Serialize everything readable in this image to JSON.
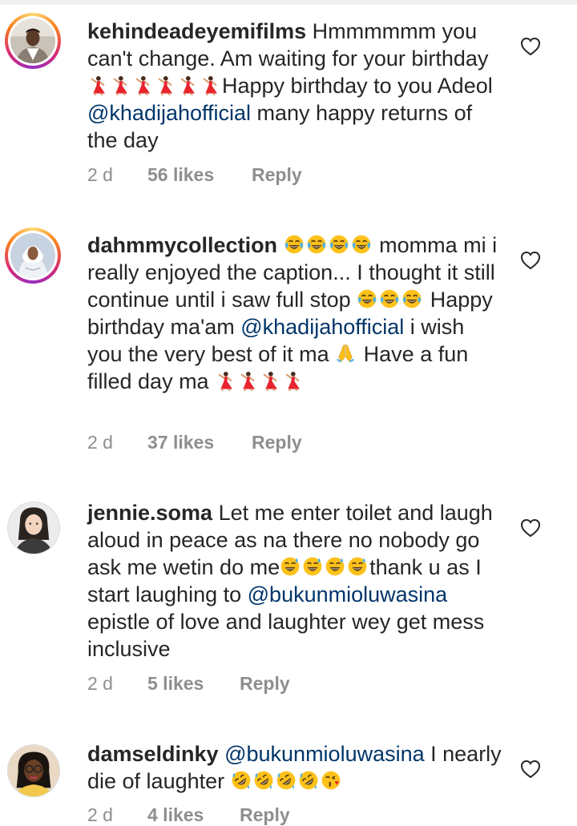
{
  "comments": [
    {
      "username": "kehindeadeyemifilms",
      "text_1": " Hmmmmmm you can't change. Am waiting for your birthday ",
      "text_2": "Happy birthday to you Adeol ",
      "mention_1": "@khadijahofficial",
      "text_3": " many happy returns of the day",
      "age": "2 d",
      "likes": "56 likes",
      "reply": "Reply"
    },
    {
      "username": "dahmmycollection",
      "text_1": " momma mi i really enjoyed the caption... I thought it still continue until i saw full stop ",
      "text_2": " Happy birthday ma'am ",
      "mention_1": "@khadijahofficial",
      "text_3": " i wish you the very best of it ma ",
      "text_4": " Have a fun filled day ma ",
      "age": "2 d",
      "likes": "37 likes",
      "reply": "Reply"
    },
    {
      "username": "jennie.soma",
      "text_1": " Let me enter toilet and laugh aloud in peace  as na there no nobody go ask me wetin do me",
      "text_2": "thank u as I start laughing to ",
      "mention_1": "@bukunmioluwasina",
      "text_3": "  epistle of love and laughter wey get mess inclusive",
      "age": "2 d",
      "likes": "5 likes",
      "reply": "Reply"
    },
    {
      "username": "damseldinky",
      "mention_1": "@bukunmioluwasina",
      "text_1": " I nearly die of laughter ",
      "age": "2 d",
      "likes": "4 likes",
      "reply": "Reply"
    }
  ],
  "icons": {
    "like": "heart-outline-icon",
    "dancer": "dancing-woman-emoji",
    "joy": "face-with-tears-of-joy-emoji",
    "sweat": "grinning-face-with-sweat-emoji",
    "rofl": "rolling-on-floor-laughing-emoji",
    "kiss": "face-blowing-kiss-emoji",
    "pray": "folded-hands-emoji"
  },
  "colors": {
    "text": "#262626",
    "secondary": "#8e8e8e",
    "mention": "#003569"
  }
}
